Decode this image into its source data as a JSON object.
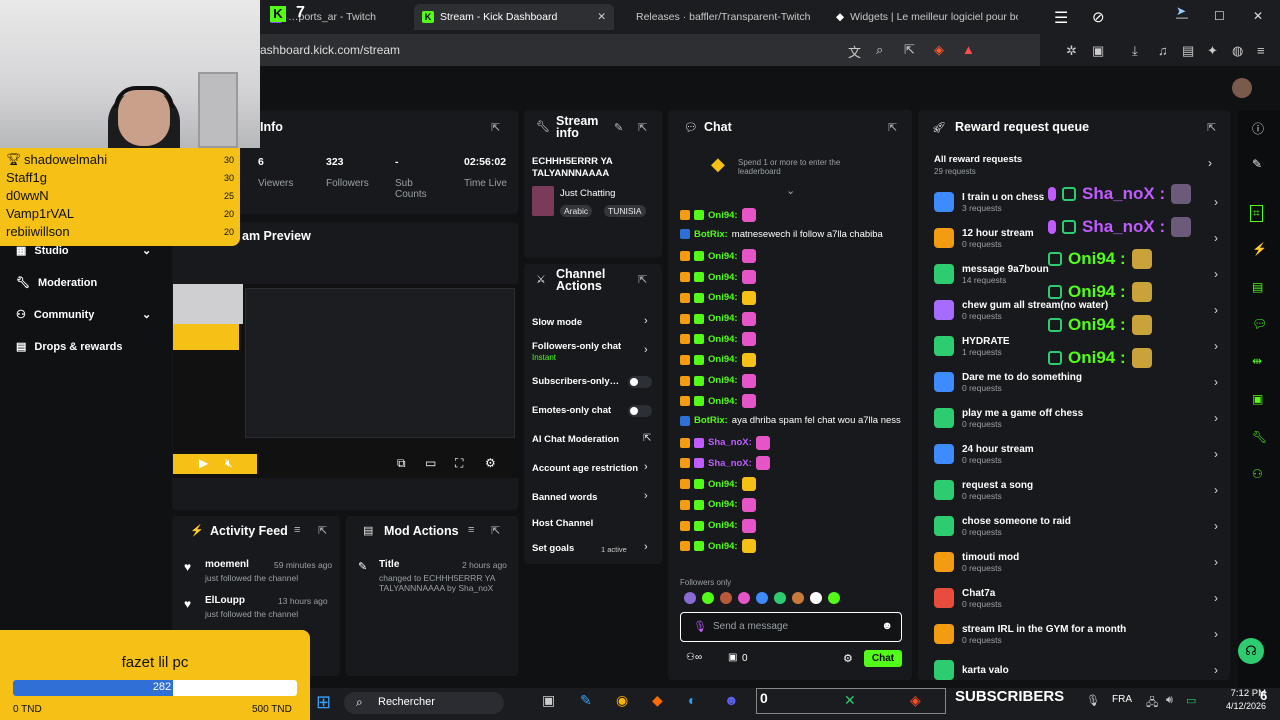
{
  "browser": {
    "tabs": [
      {
        "label": "…ports_ar - Twitch",
        "active": false
      },
      {
        "label": "Stream - Kick Dashboard",
        "active": true
      },
      {
        "label": "Releases · baffler/Transparent-Twitch",
        "active": false
      },
      {
        "label": "Widgets | Le meilleur logiciel pour bo",
        "active": false
      }
    ],
    "url": "ashboard.kick.com/stream",
    "kick_count": "7"
  },
  "nav": {
    "items": [
      "Studio",
      "Moderation",
      "Community",
      "Drops & rewards"
    ]
  },
  "leaderboard": {
    "rows": [
      {
        "name": "shadowelmahi",
        "value": "30"
      },
      {
        "name": "Staff1g",
        "value": "30"
      },
      {
        "name": "d0wwN",
        "value": "25"
      },
      {
        "name": "Vamp1rVAL",
        "value": "20"
      },
      {
        "name": "rebiiwillson",
        "value": "20"
      }
    ]
  },
  "info": {
    "title": "Info",
    "stats": [
      {
        "value": "6",
        "label": "Viewers"
      },
      {
        "value": "323",
        "label": "Followers"
      },
      {
        "value": "-",
        "label": "Sub Counts"
      },
      {
        "value": "02:56:02",
        "label": "Time Live"
      }
    ],
    "preview_title": "am Preview"
  },
  "stream_info": {
    "title": "Stream info",
    "stream_title": "ECHHH5ERRR YA TALYANNNAAAA",
    "category": "Just Chatting",
    "tags": [
      "Arabic",
      "TUNISIA"
    ]
  },
  "channel_actions": {
    "title": "Channel Actions",
    "items": [
      {
        "label": "Slow mode",
        "type": "chevron"
      },
      {
        "label": "Followers-only chat",
        "sub": "Instant",
        "type": "chevron"
      },
      {
        "label": "Subscribers-only…",
        "type": "toggle"
      },
      {
        "label": "Emotes-only chat",
        "type": "toggle"
      },
      {
        "label": "AI Chat Moderation",
        "type": "external"
      },
      {
        "label": "Account age restriction",
        "type": "chevron"
      },
      {
        "label": "Banned words",
        "type": "chevron"
      },
      {
        "label": "Host Channel",
        "type": "none"
      },
      {
        "label": "Set goals",
        "sub": "1 active",
        "type": "chevron"
      }
    ]
  },
  "activity": {
    "title": "Activity Feed",
    "items": [
      {
        "user": "moemenl",
        "action": "just followed the channel",
        "time": "59 minutes ago"
      },
      {
        "user": "ElLoupp",
        "action": "just followed the channel",
        "time": "13 hours ago"
      }
    ]
  },
  "mod_actions": {
    "title": "Mod Actions",
    "item": {
      "label": "Title",
      "time": "2 hours ago",
      "text": "changed to ECHHH5ERRR YA TALYANNNAAAA by Sha_noX"
    }
  },
  "chat": {
    "title": "Chat",
    "leaderboard_hint": "Spend 1 or more to enter the leaderboard",
    "lines": [
      {
        "user": "Oni94:",
        "kind": "oni"
      },
      {
        "user": "BotRix:",
        "kind": "bot",
        "text": "matnesewech il follow a7lla chabiba"
      },
      {
        "user": "Oni94:",
        "kind": "oni"
      },
      {
        "user": "Oni94:",
        "kind": "oni"
      },
      {
        "user": "Oni94:",
        "kind": "oni"
      },
      {
        "user": "Oni94:",
        "kind": "oni"
      },
      {
        "user": "Oni94:",
        "kind": "oni"
      },
      {
        "user": "Oni94:",
        "kind": "oni"
      },
      {
        "user": "Oni94:",
        "kind": "oni"
      },
      {
        "user": "Oni94:",
        "kind": "oni"
      },
      {
        "user": "BotRix:",
        "kind": "bot",
        "text": "aya dhriba spam fel chat wou a7lla ness"
      },
      {
        "user": "Sha_noX:",
        "kind": "sha"
      },
      {
        "user": "Sha_noX:",
        "kind": "sha"
      },
      {
        "user": "Oni94:",
        "kind": "oni"
      },
      {
        "user": "Oni94:",
        "kind": "oni"
      },
      {
        "user": "Oni94:",
        "kind": "oni"
      },
      {
        "user": "Oni94:",
        "kind": "oni"
      }
    ],
    "followers_only": "Followers only",
    "placeholder": "Send a message",
    "count": "0",
    "send_label": "Chat"
  },
  "reward_queue": {
    "title": "Reward request queue",
    "all_label": "All reward requests",
    "all_sub": "29 requests",
    "items": [
      {
        "title": "I train u on chess",
        "sub": "3 requests",
        "color": "#3d8bfd"
      },
      {
        "title": "12 hour stream",
        "sub": "0 requests",
        "color": "#f39c12"
      },
      {
        "title": "message 9a7boun",
        "sub": "14 requests",
        "color": "#2ecc71"
      },
      {
        "title": "chew gum all stream(no water)",
        "sub": "0 requests",
        "color": "#a66bff"
      },
      {
        "title": "HYDRATE",
        "sub": "1 requests",
        "color": "#2ecc71"
      },
      {
        "title": "Dare me to do something",
        "sub": "0 requests",
        "color": "#3d8bfd"
      },
      {
        "title": "play me a game off chess",
        "sub": "0 requests",
        "color": "#2ecc71"
      },
      {
        "title": "24 hour stream",
        "sub": "0 requests",
        "color": "#3d8bfd"
      },
      {
        "title": "request a song",
        "sub": "0 requests",
        "color": "#2ecc71"
      },
      {
        "title": "chose someone to raid",
        "sub": "0 requests",
        "color": "#2ecc71"
      },
      {
        "title": "timouti mod",
        "sub": "0 requests",
        "color": "#f39c12"
      },
      {
        "title": "Chat7a",
        "sub": "0 requests",
        "color": "#e74c3c"
      },
      {
        "title": "stream IRL in the GYM for a month",
        "sub": "0 requests",
        "color": "#f39c12"
      },
      {
        "title": "karta valo",
        "sub": "",
        "color": "#2ecc71"
      }
    ]
  },
  "overlay_chat": [
    {
      "name": "Sha_noX :",
      "kind": "sha"
    },
    {
      "name": "Sha_noX :",
      "kind": "sha"
    },
    {
      "name": "Oni94 :",
      "kind": "oni"
    },
    {
      "name": "Oni94 :",
      "kind": "oni"
    },
    {
      "name": "Oni94 :",
      "kind": "oni"
    },
    {
      "name": "Oni94 :",
      "kind": "oni"
    }
  ],
  "goal": {
    "title": "fazet lil pc",
    "current": "282",
    "progress": 0.564,
    "min_label": "0 TND",
    "max_label": "500 TND"
  },
  "taskbar": {
    "search": "Rechercher",
    "subs_label": "SUBSCRIBERS",
    "subs_count": "0",
    "lang": "FRA",
    "time": "7:12 PM",
    "date": "4/12/2026",
    "extra": "6"
  },
  "colors": {
    "kick_green": "#53fc18",
    "goal_yellow": "#f5c116",
    "progress_blue": "#2f6fd6"
  }
}
